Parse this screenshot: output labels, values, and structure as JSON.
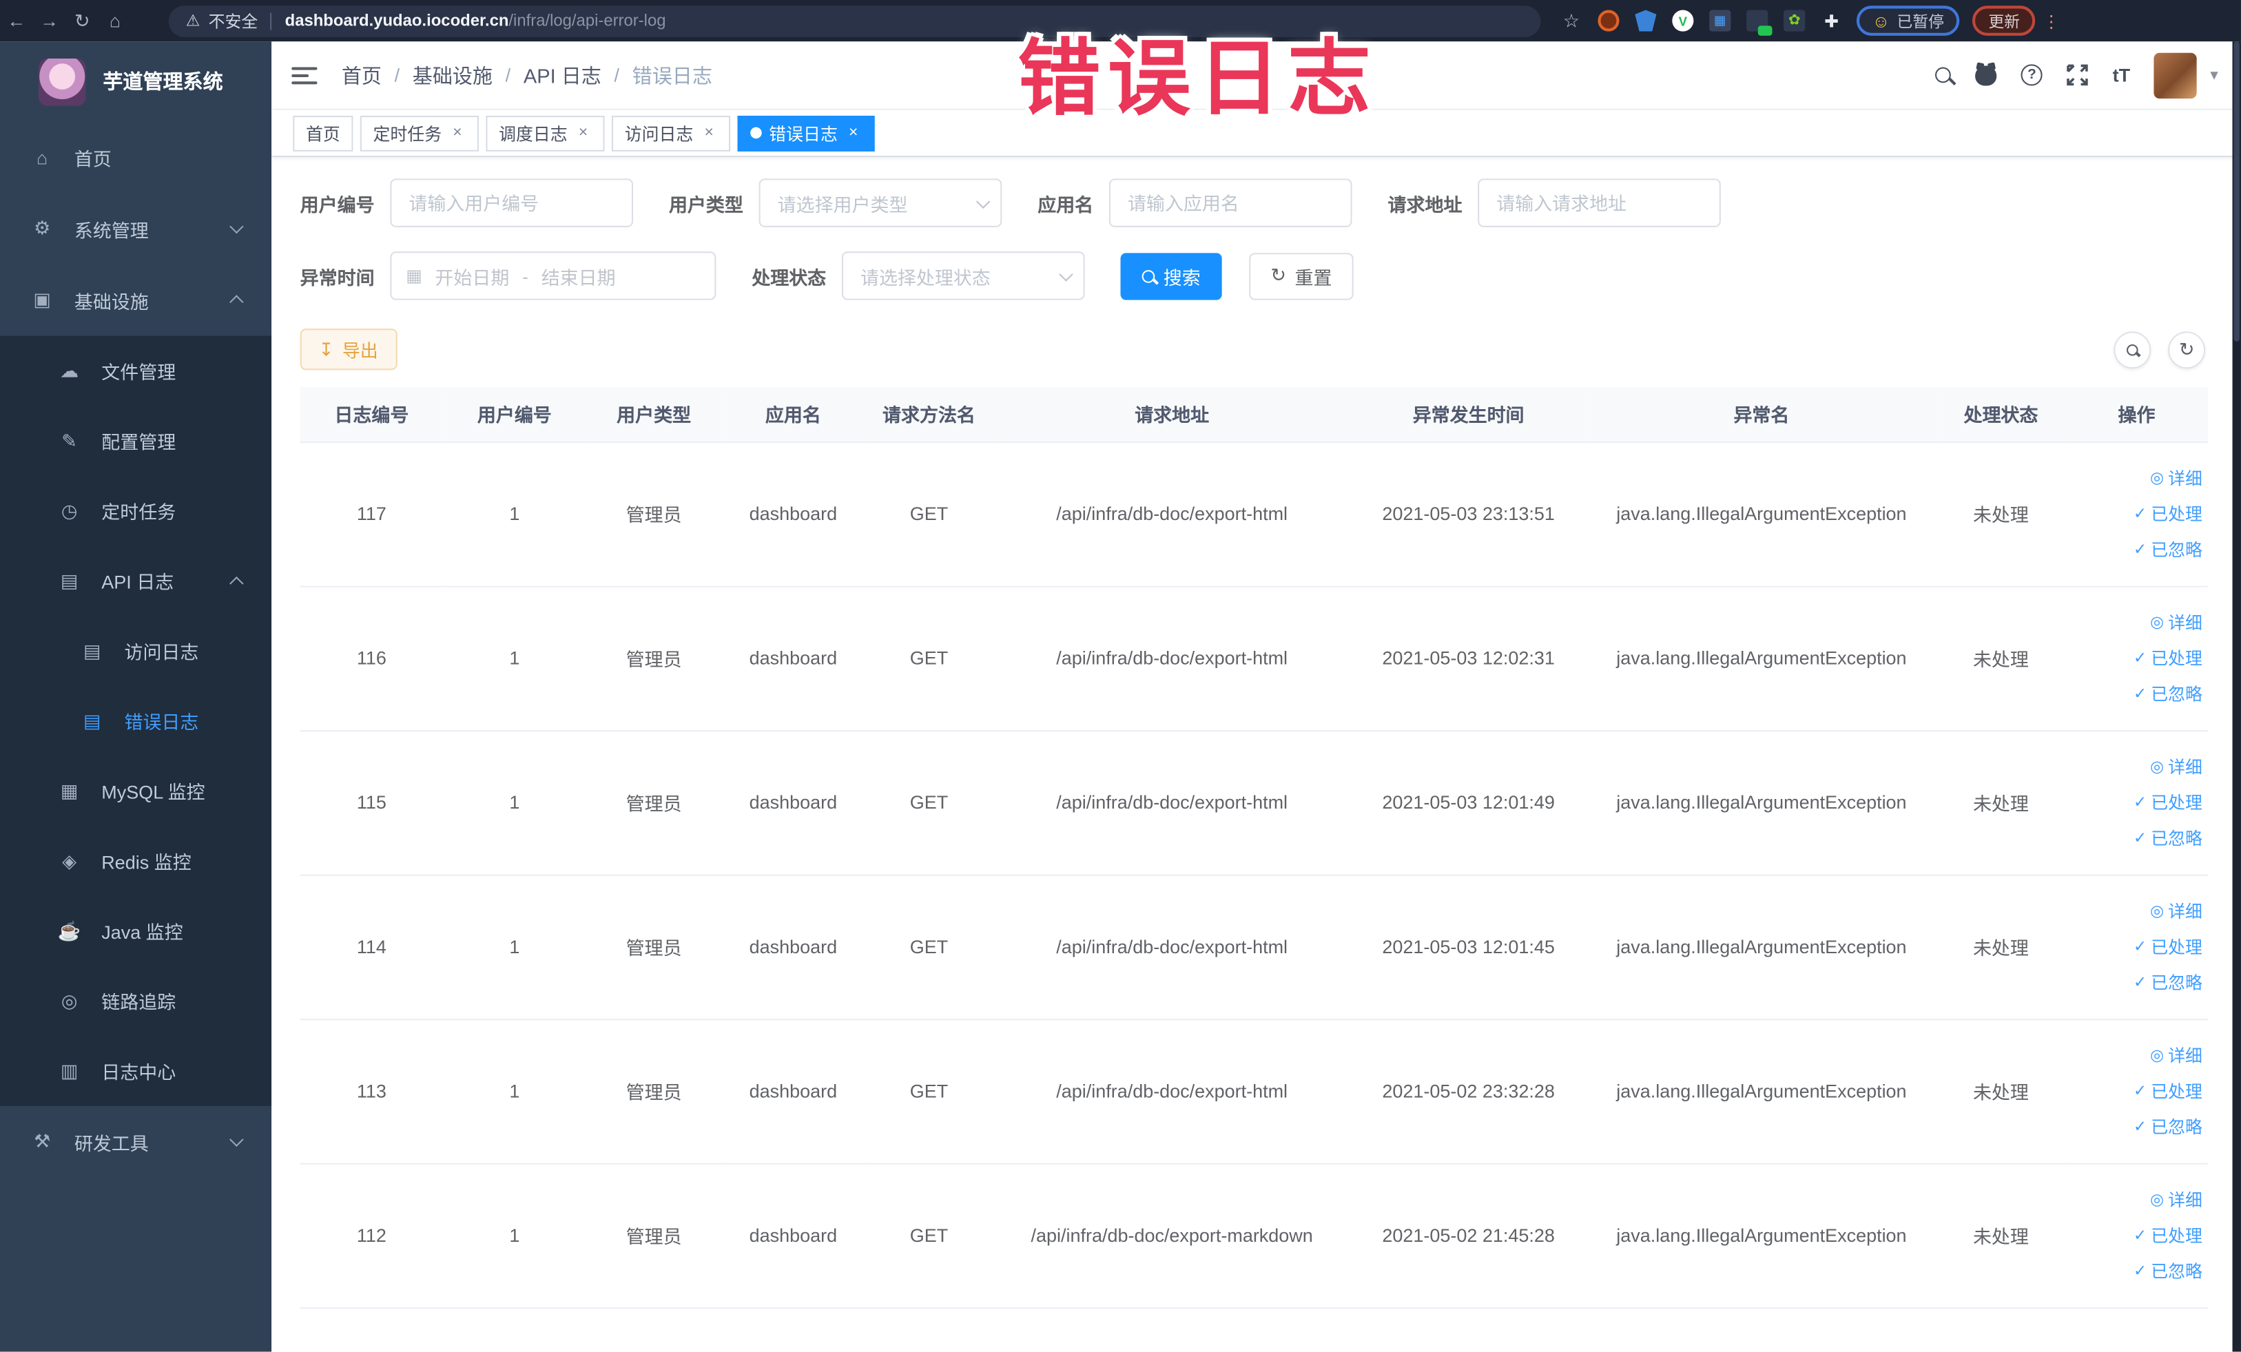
{
  "ui": {
    "close_glyph": "×",
    "breadcrumb_separator": "/",
    "caret_glyph": "▾",
    "dots_glyph": "⋮"
  },
  "colors": {
    "accent": "#1890ff",
    "link": "#409eff",
    "warning_button": "#e6a23c",
    "overlay": "#ea3658",
    "sidebar_bg": "#304156",
    "submenu_bg": "#1f2d3d"
  },
  "overlay": {
    "title": "错误日志"
  },
  "browser": {
    "security_label": "不安全",
    "url_host": "dashboard.yudao.iocoder.cn",
    "url_path": "/infra/log/api-error-log",
    "paused_badge": "已暂停",
    "update_button": "更新"
  },
  "icons": {
    "back": "←",
    "forward": "→",
    "reload": "↻",
    "home": "⌂",
    "warning": "⚠",
    "star": "☆",
    "puzzle": "✚",
    "sprout": "✿",
    "grid": "▦",
    "green_v": "V",
    "smiley": "☺",
    "help": "?",
    "font_size": "tT",
    "calendar": "▦",
    "download": "↧",
    "refresh": "↻",
    "eye": "◎",
    "check": "✓",
    "menu_home": "⌂",
    "menu_gear": "⚙",
    "menu_infra": "▣",
    "menu_file": "☁",
    "menu_config": "✎",
    "menu_timer": "◷",
    "menu_api_log": "▤",
    "menu_access_log": "▤",
    "menu_error_log": "▤",
    "menu_mysql": "▦",
    "menu_redis": "◈",
    "menu_java": "☕",
    "menu_trace": "◎",
    "menu_log_center": "▥",
    "menu_dev_tools": "⚒"
  },
  "sidebar": {
    "logo_title": "芋道管理系统",
    "items": {
      "home": "首页",
      "system": "系统管理",
      "infra": "基础设施",
      "file": "文件管理",
      "config": "配置管理",
      "job": "定时任务",
      "api_log": "API 日志",
      "access_log": "访问日志",
      "error_log": "错误日志",
      "mysql": "MySQL 监控",
      "redis": "Redis 监控",
      "java": "Java 监控",
      "trace": "链路追踪",
      "log_center": "日志中心",
      "dev_tools": "研发工具"
    }
  },
  "navbar": {
    "breadcrumb": [
      "首页",
      "基础设施",
      "API 日志",
      "错误日志"
    ]
  },
  "tabs": {
    "home": "首页",
    "job": "定时任务",
    "job_log": "调度日志",
    "access_log": "访问日志",
    "error_log": "错误日志"
  },
  "filters": {
    "user_id": {
      "label": "用户编号",
      "placeholder": "请输入用户编号"
    },
    "user_type": {
      "label": "用户类型",
      "placeholder": "请选择用户类型"
    },
    "app_name": {
      "label": "应用名",
      "placeholder": "请输入应用名"
    },
    "request_url": {
      "label": "请求地址",
      "placeholder": "请输入请求地址"
    },
    "exception_time": {
      "label": "异常时间",
      "start_placeholder": "开始日期",
      "separator": "-",
      "end_placeholder": "结束日期"
    },
    "process_status": {
      "label": "处理状态",
      "placeholder": "请选择处理状态"
    },
    "search_button": "搜索",
    "reset_button": "重置"
  },
  "toolbar": {
    "export_button": "导出"
  },
  "table": {
    "headers": [
      "日志编号",
      "用户编号",
      "用户类型",
      "应用名",
      "请求方法名",
      "请求地址",
      "异常发生时间",
      "异常名",
      "处理状态",
      "操作"
    ],
    "actions": {
      "detail": "详细",
      "processed": "已处理",
      "ignored": "已忽略"
    },
    "rows": [
      {
        "id": "117",
        "user_id": "1",
        "user_type": "管理员",
        "app": "dashboard",
        "method": "GET",
        "url": "/api/infra/db-doc/export-html",
        "time": "2021-05-03 23:13:51",
        "exception": "java.lang.IllegalArgumentException",
        "status": "未处理"
      },
      {
        "id": "116",
        "user_id": "1",
        "user_type": "管理员",
        "app": "dashboard",
        "method": "GET",
        "url": "/api/infra/db-doc/export-html",
        "time": "2021-05-03 12:02:31",
        "exception": "java.lang.IllegalArgumentException",
        "status": "未处理"
      },
      {
        "id": "115",
        "user_id": "1",
        "user_type": "管理员",
        "app": "dashboard",
        "method": "GET",
        "url": "/api/infra/db-doc/export-html",
        "time": "2021-05-03 12:01:49",
        "exception": "java.lang.IllegalArgumentException",
        "status": "未处理"
      },
      {
        "id": "114",
        "user_id": "1",
        "user_type": "管理员",
        "app": "dashboard",
        "method": "GET",
        "url": "/api/infra/db-doc/export-html",
        "time": "2021-05-03 12:01:45",
        "exception": "java.lang.IllegalArgumentException",
        "status": "未处理"
      },
      {
        "id": "113",
        "user_id": "1",
        "user_type": "管理员",
        "app": "dashboard",
        "method": "GET",
        "url": "/api/infra/db-doc/export-html",
        "time": "2021-05-02 23:32:28",
        "exception": "java.lang.IllegalArgumentException",
        "status": "未处理"
      },
      {
        "id": "112",
        "user_id": "1",
        "user_type": "管理员",
        "app": "dashboard",
        "method": "GET",
        "url": "/api/infra/db-doc/export-markdown",
        "time": "2021-05-02 21:45:28",
        "exception": "java.lang.IllegalArgumentException",
        "status": "未处理"
      }
    ]
  }
}
